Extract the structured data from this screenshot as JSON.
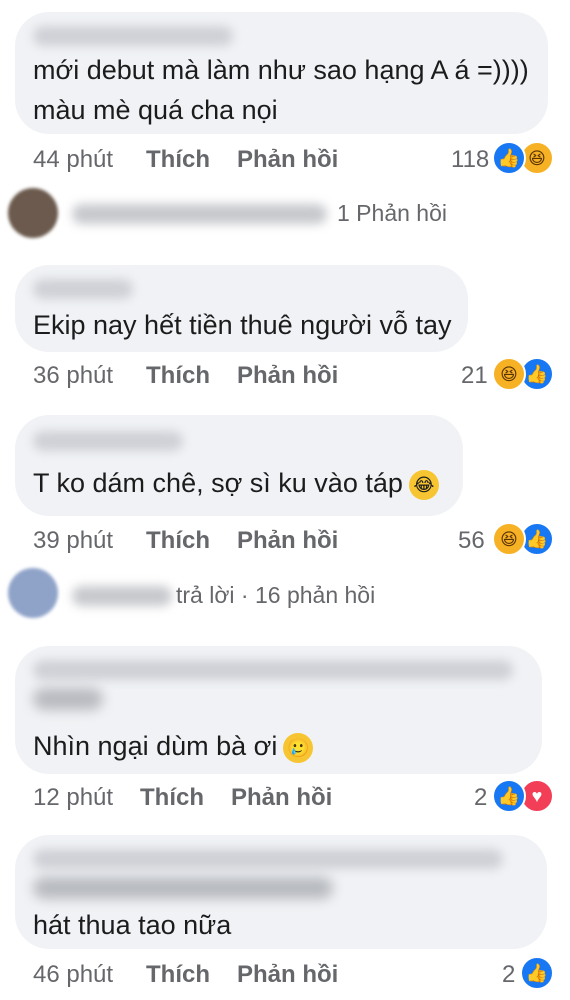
{
  "comments": [
    {
      "text_lines": [
        "mới debut mà làm như sao hạng A á =))))",
        "màu mè quá cha nọi"
      ],
      "time": "44 phút",
      "like_label": "Thích",
      "reply_label": "Phản hồi",
      "reaction_count": "118",
      "reactions": [
        "like-icon",
        "haha-icon"
      ]
    },
    {
      "text_lines": [
        "Ekip nay hết tiền thuê người vỗ tay"
      ],
      "time": "36 phút",
      "like_label": "Thích",
      "reply_label": "Phản hồi",
      "reaction_count": "21",
      "reactions": [
        "haha-icon",
        "like-icon"
      ]
    },
    {
      "text_lines": [
        "T ko dám chê, sợ sì ku vào táp"
      ],
      "emoji": "😂",
      "time": "39 phút",
      "like_label": "Thích",
      "reply_label": "Phản hồi",
      "reaction_count": "56",
      "reactions": [
        "haha-icon",
        "like-icon"
      ]
    },
    {
      "text_lines": [
        "Nhìn ngại dùm bà ơi"
      ],
      "emoji": "🥲",
      "time": "12 phút",
      "like_label": "Thích",
      "reply_label": "Phản hồi",
      "reaction_count": "2",
      "reactions": [
        "like-icon",
        "love-icon"
      ]
    },
    {
      "text_lines": [
        "hát thua tao nữa"
      ],
      "time": "46 phút",
      "like_label": "Thích",
      "reply_label": "Phản hồi",
      "reaction_count": "2",
      "reactions": [
        "like-icon"
      ]
    }
  ],
  "reply_summaries": [
    {
      "text": "1 Phản hồi"
    },
    {
      "text": "trả lời · 16 phản hồi"
    }
  ],
  "colors": {
    "bubble": "#f0f2f5",
    "meta_text": "#65676b",
    "like_blue": "#1877f2",
    "haha_yellow": "#f7b125",
    "love_red": "#f33e58"
  }
}
